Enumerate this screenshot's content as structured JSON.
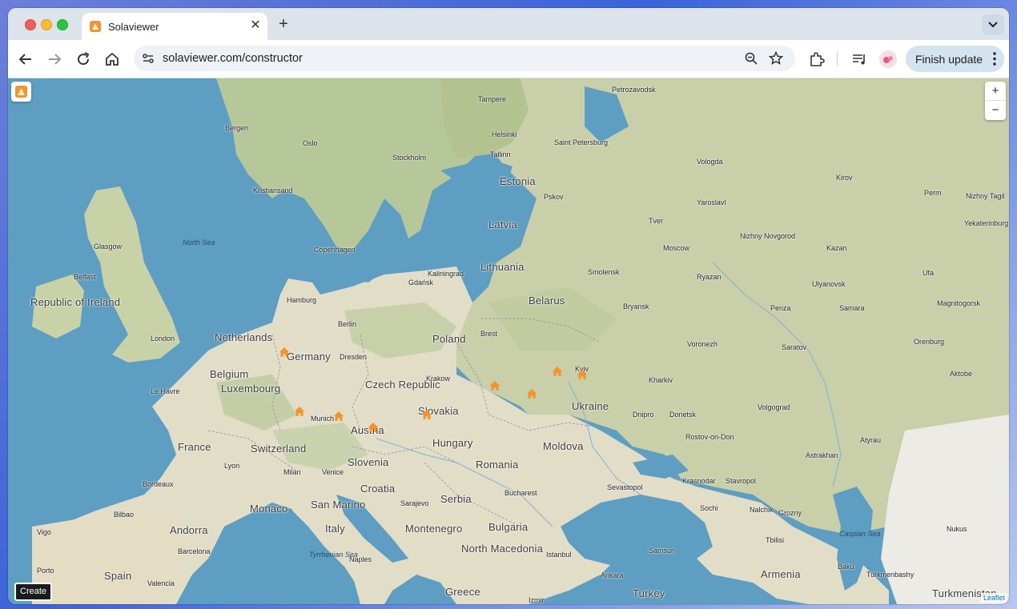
{
  "browser": {
    "tab_title": "Solaviewer",
    "url": "solaviewer.com/constructor",
    "finish_update_label": "Finish update"
  },
  "map": {
    "create_label": "Create",
    "zoom_in": "+",
    "zoom_out": "−",
    "attribution": "Leaflet",
    "countries": [
      "Republic of Ireland",
      "Netherlands",
      "Belgium",
      "Luxembourg",
      "Germany",
      "France",
      "Switzerland",
      "Austria",
      "Czech Republic",
      "Slovakia",
      "Poland",
      "Hungary",
      "Slovenia",
      "Croatia",
      "Romania",
      "Moldova",
      "Ukraine",
      "Belarus",
      "Lithuania",
      "Latvia",
      "Estonia",
      "Serbia",
      "Bulgaria",
      "Italy",
      "Spain",
      "Andorra",
      "Monaco",
      "San Marino",
      "Montenegro",
      "North Macedonia",
      "Turkey",
      "Greece",
      "Armenia",
      "Turkmenistan"
    ],
    "cities": [
      "Tampere",
      "Petrozavodsk",
      "Bergen",
      "Helsinki",
      "Saint Petersburg",
      "Oslo",
      "Tallinn",
      "Stockholm",
      "Vologda",
      "Kirov",
      "Kristiansand",
      "Pskov",
      "Yaroslavl",
      "Perm",
      "Nizhny Tagil",
      "Glasgow",
      "Tver",
      "Yekaterinburg",
      "Nizhny Novgorod",
      "Kazan",
      "Copenhagen",
      "Moscow",
      "Belfast",
      "Kaliningrad",
      "Gdańsk",
      "Smolensk",
      "Ryazan",
      "Ufa",
      "Hamburg",
      "Ulyanovsk",
      "Magnitogorsk",
      "Bryansk",
      "Penza",
      "Samara",
      "Berlin",
      "London",
      "Brest",
      "Voronezh",
      "Saratov",
      "Orenburg",
      "Dresden",
      "Kyiv",
      "Kharkiv",
      "Aktobe",
      "Le Havre",
      "Krakow",
      "Dnipro",
      "Donetsk",
      "Volgograd",
      "Munich",
      "Rostov-on-Don",
      "Atyrau",
      "Lyon",
      "Astrakhan",
      "Milan",
      "Venice",
      "Bordeaux",
      "Sarajevo",
      "Bucharest",
      "Sevastopol",
      "Krasnodar",
      "Stavropol",
      "Sochi",
      "Nalchik",
      "Grozny",
      "Bilbao",
      "Barcelona",
      "Istanbul",
      "Samsun",
      "Tbilisi",
      "Nukus",
      "Naples",
      "Ankara",
      "Baku",
      "Turkmenbashy",
      "Valencia",
      "Izmir",
      "Vigo",
      "Porto"
    ],
    "seas": [
      "North Sea",
      "Tyrrhenian Sea",
      "Caspian Sea"
    ],
    "marker_icon": "home-marker-icon",
    "accent_color": "#f5922b"
  }
}
